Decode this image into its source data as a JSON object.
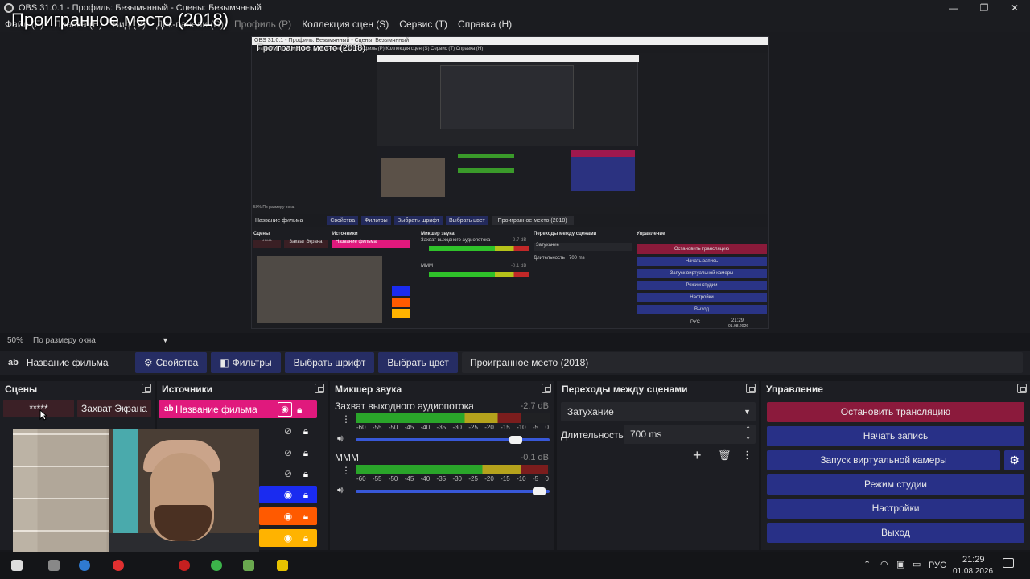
{
  "window": {
    "title": "OBS 31.0.1 - Профиль: Безымянный - Сцены: Безымянный",
    "controls": {
      "minimize": "—",
      "maximize": "❐",
      "close": "✕"
    }
  },
  "menu": {
    "items": [
      "Файл (F)",
      "Правка (E)",
      "Вид (V)",
      "Док-панели (D)",
      "Профиль (P)",
      "Коллекция сцен (S)",
      "Сервис (T)",
      "Справка (H)"
    ]
  },
  "overlay_title": "Проигранное место (2018)",
  "preview": {
    "zoom": "50%",
    "fit_mode": "По размеру окна",
    "nested": {
      "title": "OBS 31.0.1 - Профиль: Безымянный - Сцены: Безымянный",
      "overlay_title": "Проигранное место (2018)",
      "menu": "Файл (F)   Правка (E)   Вид (V)   Док-панели (D)   Профиль (P)   Коллекция сцен (S)   Сервис (T)   Справка (H)",
      "status": "50%   По размеру окна",
      "toolbar": {
        "source_name": "Название фильма",
        "properties": "Свойства",
        "filters": "Фильтры",
        "font": "Выбрать шрифт",
        "color": "Выбрать цвет",
        "text": "Проигранное место (2018)"
      },
      "docks": {
        "scenes": "Сцены",
        "sources": "Источники",
        "mixer": "Микшер звука",
        "transitions": "Переходы между сценами",
        "controls": "Управление",
        "scene1": "*****",
        "scene2": "Захват Экрана",
        "source1": "Название фильма",
        "track1": "Захват выходного аудиопотока",
        "track1_db": "-2.7 dB",
        "track2": "МММ",
        "track2_db": "-0.1 dB",
        "transition": "Затухание",
        "duration_label": "Длительность",
        "duration": "700 ms",
        "buttons": [
          "Остановить трансляцию",
          "Начать запись",
          "Запуск виртуальной камеры",
          "Режим студии",
          "Настройки",
          "Выход"
        ]
      },
      "clock_time": "21:29",
      "clock_date": "01.08.2026",
      "lang": "РУС"
    }
  },
  "context_toolbar": {
    "source_icon": "ab",
    "source_name": "Название фильма",
    "properties": "Свойства",
    "filters": "Фильтры",
    "select_font": "Выбрать шрифт",
    "select_color": "Выбрать цвет",
    "text_value": "Проигранное место (2018)"
  },
  "docks": {
    "scenes": {
      "title": "Сцены",
      "items": [
        "*****",
        "Захват Экрана"
      ]
    },
    "sources": {
      "title": "Источники",
      "first": {
        "icon": "ab",
        "name": "Название фильма"
      }
    },
    "mixer": {
      "title": "Микшер звука",
      "scale": [
        "-60",
        "-55",
        "-50",
        "-45",
        "-40",
        "-35",
        "-30",
        "-25",
        "-20",
        "-15",
        "-10",
        "-5",
        "0"
      ],
      "tracks": [
        {
          "name": "Захват выходного аудиопотока",
          "db": "-2.7 dB",
          "level": 0.85,
          "volume": 0.86
        },
        {
          "name": "МММ",
          "db": "-0.1 dB",
          "level": 0.99,
          "volume": 0.98
        }
      ]
    },
    "transitions": {
      "title": "Переходы между сценами",
      "selected": "Затухание",
      "duration_label": "Длительность",
      "duration": "700 ms"
    },
    "controls": {
      "title": "Управление",
      "stop_stream": "Остановить трансляцию",
      "start_record": "Начать запись",
      "virtual_cam": "Запуск виртуальной камеры",
      "studio_mode": "Режим студии",
      "settings": "Настройки",
      "exit": "Выход"
    }
  },
  "taskbar": {
    "lang": "РУС",
    "time": "21:29",
    "date": "01.08.2026"
  },
  "colors": {
    "accent_blue": "#283087",
    "stop_red": "#8b1a3c",
    "source_pink": "#e0197d",
    "source_blue": "#1a2bf0",
    "source_orange": "#ff5a00",
    "source_yellow": "#ffb300"
  }
}
